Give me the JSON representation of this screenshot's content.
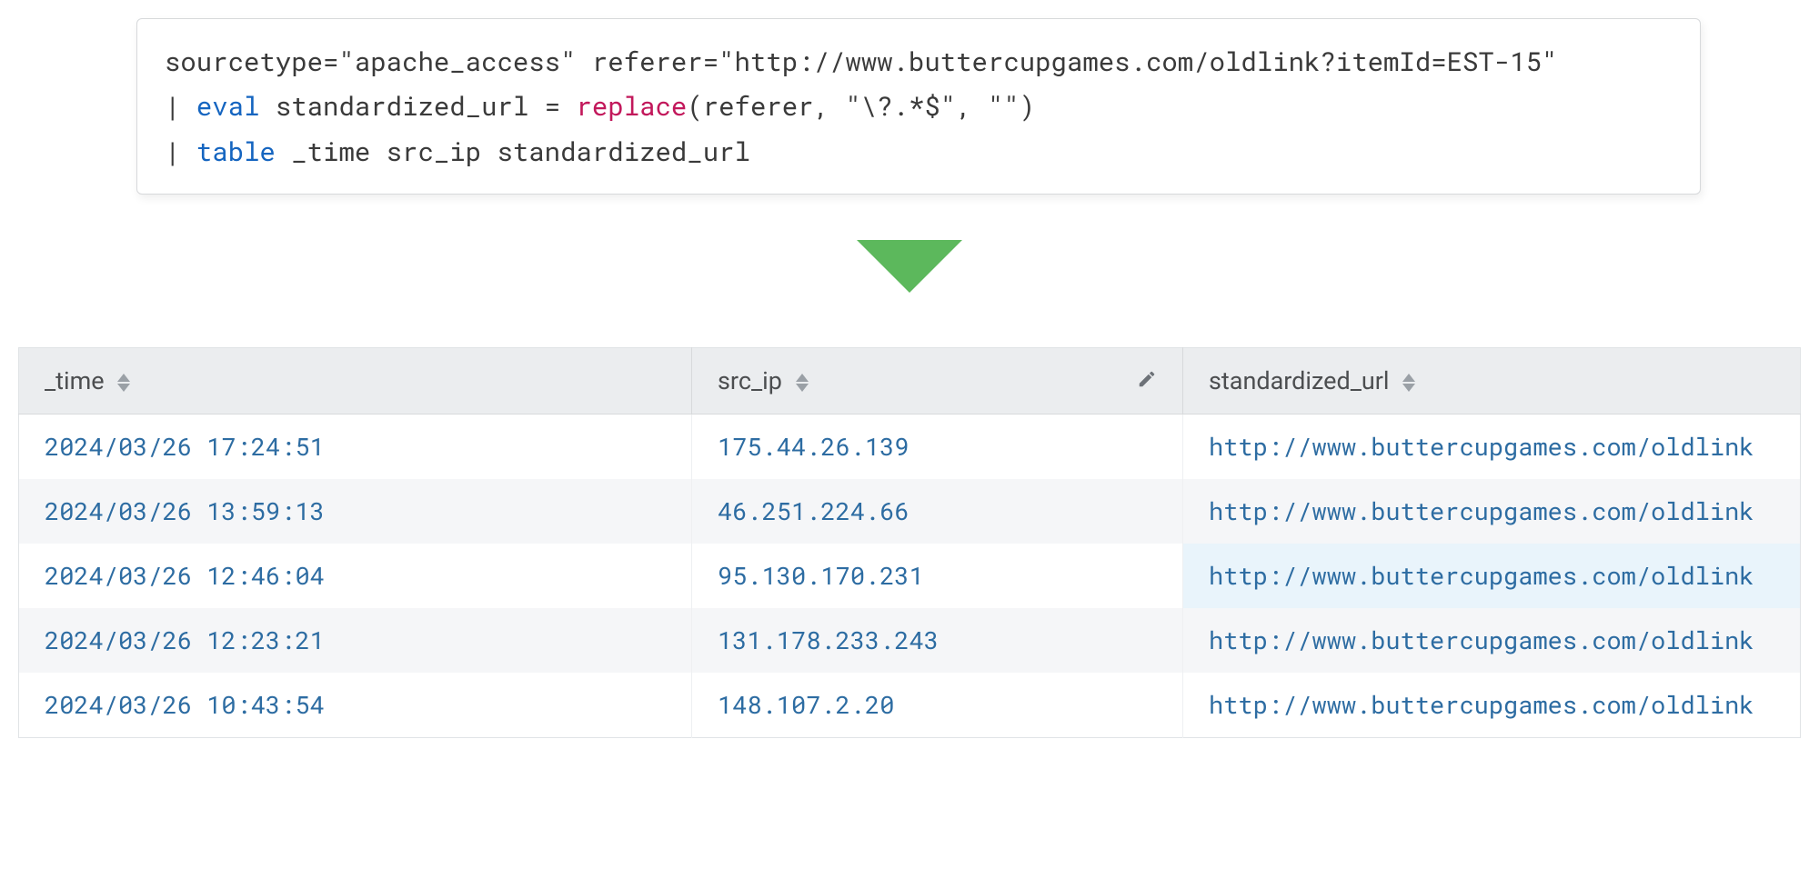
{
  "query": {
    "line1": {
      "text": "sourcetype=\"apache_access\" referer=\"http://www.buttercupgames.com/oldlink?itemId=EST-15\""
    },
    "line2": {
      "pipe": "| ",
      "eval": "eval",
      "mid": " standardized_url = ",
      "func": "replace",
      "tail": "(referer, \"\\?.*$\", \"\")"
    },
    "line3": {
      "pipe": "| ",
      "table": "table",
      "tail": " _time src_ip standardized_url"
    }
  },
  "columns": {
    "time": "_time",
    "src_ip": "src_ip",
    "standardized_url": "standardized_url"
  },
  "rows": [
    {
      "time": "2024/03/26 17:24:51",
      "src_ip": "175.44.26.139",
      "url": "http://www.buttercupgames.com/oldlink"
    },
    {
      "time": "2024/03/26 13:59:13",
      "src_ip": "46.251.224.66",
      "url": "http://www.buttercupgames.com/oldlink"
    },
    {
      "time": "2024/03/26 12:46:04",
      "src_ip": "95.130.170.231",
      "url": "http://www.buttercupgames.com/oldlink"
    },
    {
      "time": "2024/03/26 12:23:21",
      "src_ip": "131.178.233.243",
      "url": "http://www.buttercupgames.com/oldlink"
    },
    {
      "time": "2024/03/26 10:43:54",
      "src_ip": "148.107.2.20",
      "url": "http://www.buttercupgames.com/oldlink"
    }
  ]
}
